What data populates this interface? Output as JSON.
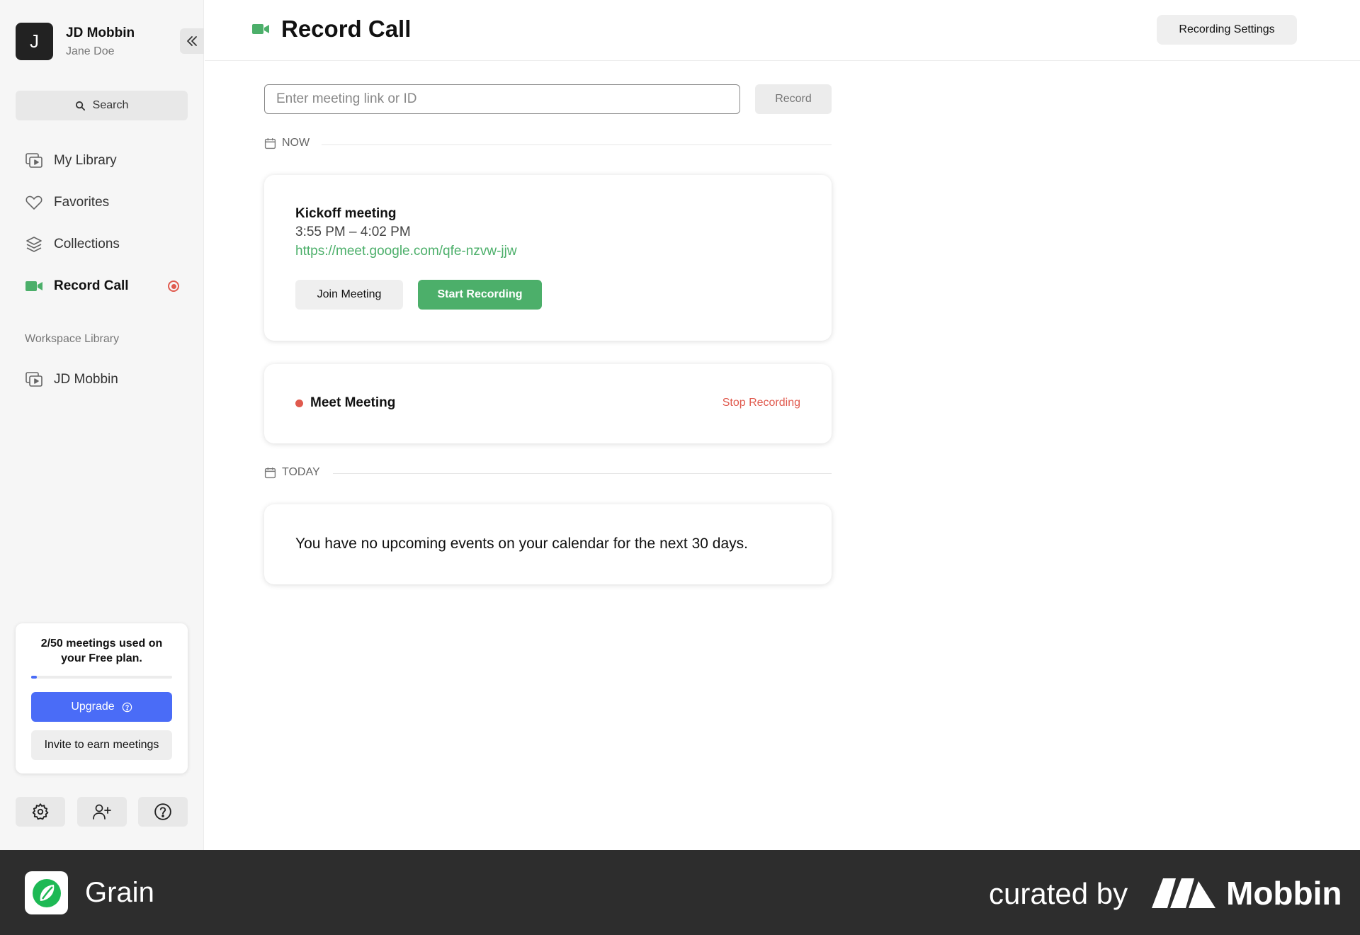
{
  "profile": {
    "initial": "J",
    "name": "JD Mobbin",
    "subtitle": "Jane Doe"
  },
  "search": {
    "label": "Search"
  },
  "nav": [
    {
      "label": "My Library",
      "icon": "library-icon"
    },
    {
      "label": "Favorites",
      "icon": "heart-icon"
    },
    {
      "label": "Collections",
      "icon": "layers-icon"
    },
    {
      "label": "Record Call",
      "icon": "video-camera-icon",
      "active": true
    }
  ],
  "workspace": {
    "label": "Workspace Library",
    "items": [
      {
        "label": "JD Mobbin",
        "icon": "library-icon"
      }
    ]
  },
  "plan": {
    "text": "2/50 meetings used on your Free plan.",
    "used": 2,
    "total": 50,
    "upgrade_label": "Upgrade",
    "invite_label": "Invite to earn meetings"
  },
  "header": {
    "title": "Record Call",
    "settings_label": "Recording Settings"
  },
  "meeting_input": {
    "placeholder": "Enter meeting link or ID",
    "record_label": "Record"
  },
  "sections": {
    "now": "NOW",
    "today": "TODAY"
  },
  "kickoff": {
    "title": "Kickoff meeting",
    "time": "3:55 PM – 4:02 PM",
    "link": "https://meet.google.com/qfe-nzvw-jjw",
    "join_label": "Join Meeting",
    "start_label": "Start Recording"
  },
  "meet": {
    "title": "Meet Meeting",
    "stop_label": "Stop Recording"
  },
  "empty": {
    "text": "You have no upcoming events on your calendar for the next 30 days."
  },
  "footer": {
    "app_name": "Grain",
    "curated_label": "curated by",
    "brand": "Mobbin"
  },
  "colors": {
    "accent_green": "#4caf6a",
    "accent_blue": "#4a6cf7",
    "record_red": "#e05a4e"
  }
}
